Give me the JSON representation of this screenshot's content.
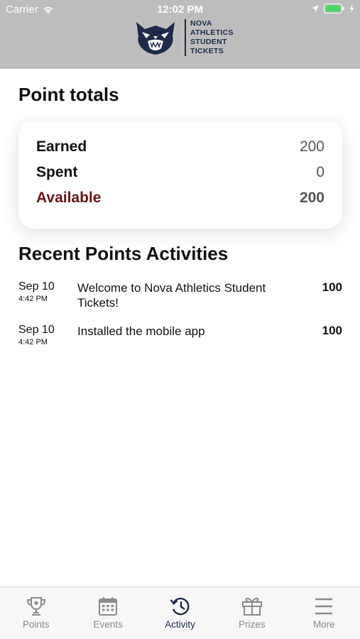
{
  "status_bar": {
    "carrier": "Carrier",
    "time": "12:02 PM"
  },
  "header": {
    "logo_lines": [
      "NOVA",
      "ATHLETICS",
      "STUDENT",
      "TICKETS"
    ]
  },
  "point_totals": {
    "title": "Point totals",
    "rows": [
      {
        "label": "Earned",
        "value": "200"
      },
      {
        "label": "Spent",
        "value": "0"
      },
      {
        "label": "Available",
        "value": "200"
      }
    ]
  },
  "recent_activities": {
    "title": "Recent Points Activities",
    "items": [
      {
        "date": "Sep 10",
        "time": "4:42 PM",
        "description": "Welcome to Nova Athletics Student Tickets!",
        "points": "100"
      },
      {
        "date": "Sep 10",
        "time": "4:42 PM",
        "description": "Installed the mobile app",
        "points": "100"
      }
    ]
  },
  "tab_bar": {
    "active": "Activity",
    "tabs": [
      {
        "label": "Points",
        "icon": "trophy-icon"
      },
      {
        "label": "Events",
        "icon": "calendar-icon"
      },
      {
        "label": "Activity",
        "icon": "history-icon"
      },
      {
        "label": "Prizes",
        "icon": "gift-icon"
      },
      {
        "label": "More",
        "icon": "menu-icon"
      }
    ]
  },
  "colors": {
    "header_bg": "#bdbdbd",
    "available_label": "#6b1414",
    "brand_navy": "#1e2a4a",
    "tab_inactive": "#8a8a8a"
  }
}
